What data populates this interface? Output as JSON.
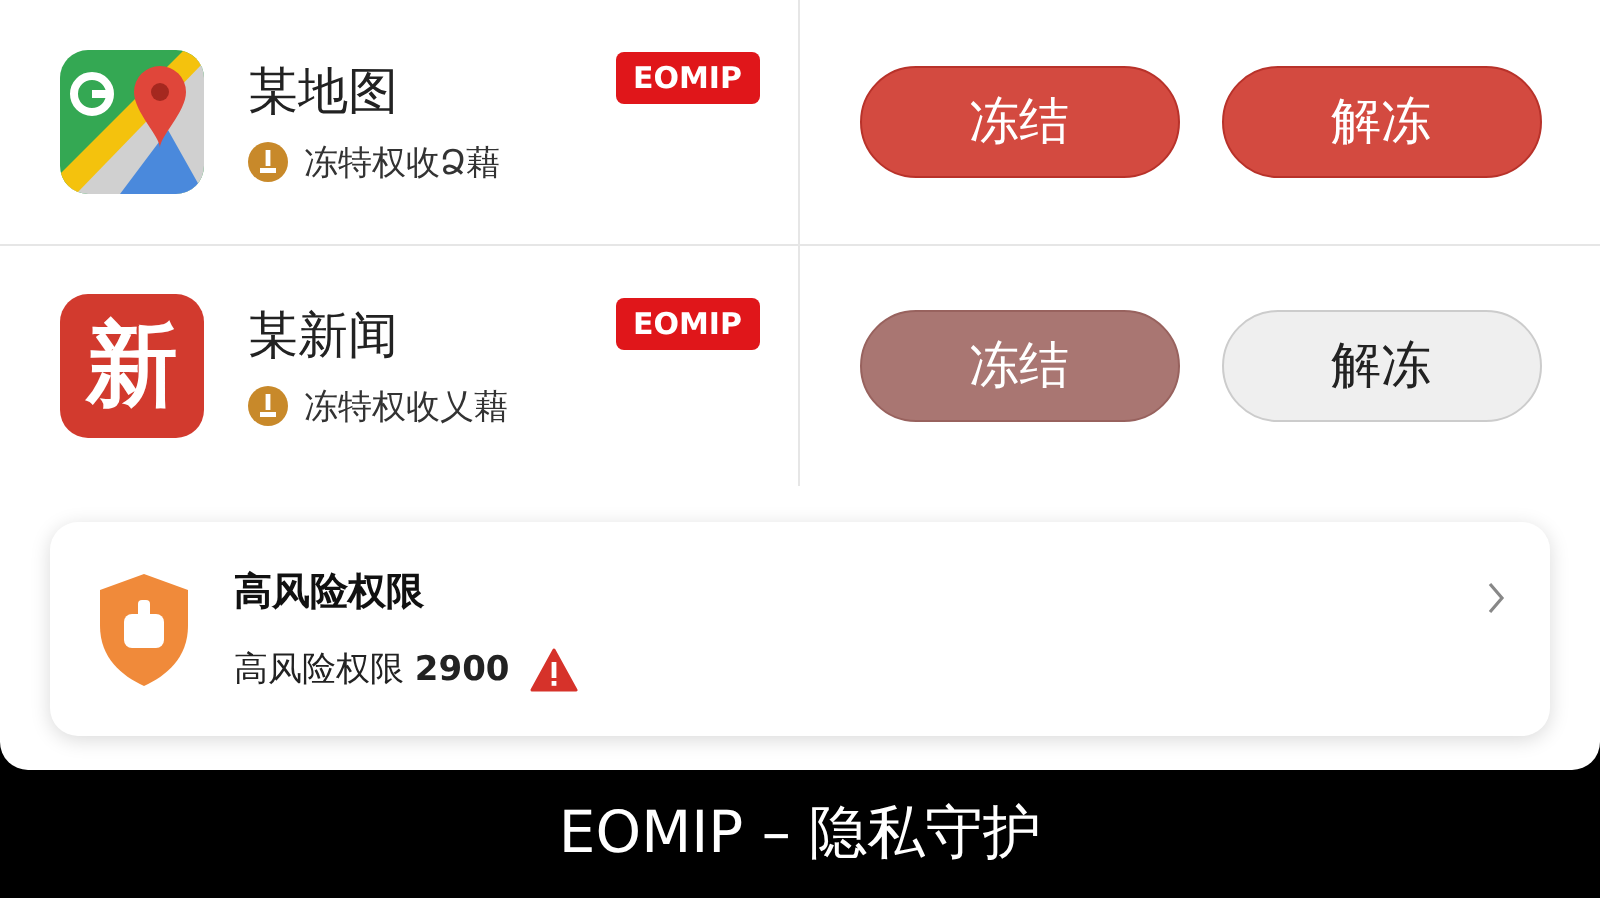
{
  "apps": [
    {
      "name": "某地图",
      "kind": "map",
      "badge": "EOMIP",
      "status": "冻特权收Ձ藉",
      "buttons": [
        {
          "label": "冻结",
          "kind": "primary"
        },
        {
          "label": "解冻",
          "kind": "primary"
        }
      ]
    },
    {
      "name": "某新闻",
      "kind": "news",
      "icon_text": "新",
      "badge": "EOMIP",
      "status": "冻特权收乂藉",
      "buttons": [
        {
          "label": "冻结",
          "kind": "dimmed"
        },
        {
          "label": "解冻",
          "kind": "plain"
        }
      ]
    }
  ],
  "risk_card": {
    "title": "高风险权限",
    "subtitle": "高风险权限 **2900**"
  },
  "caption": "EOMIP – 隐私守护"
}
